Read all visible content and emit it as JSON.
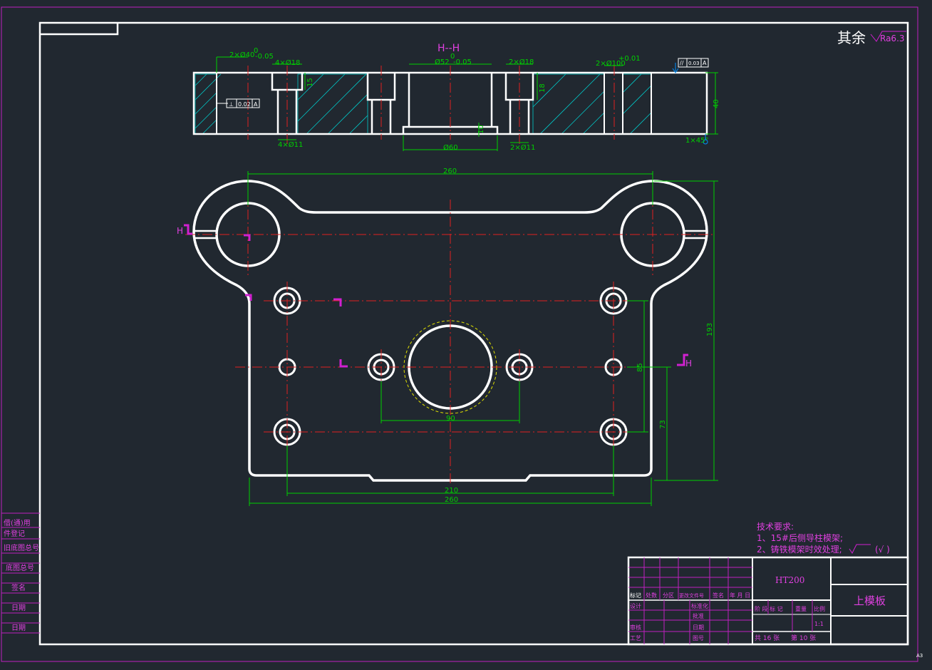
{
  "drawing": {
    "surface_note": {
      "prefix": "其余",
      "value": "Ra6.3"
    },
    "section_label": "H--H",
    "section_dims": {
      "d40": "2×Ø40",
      "d40_tol_upper": "0",
      "d40_tol_lower": "-0.05",
      "d18_left": "4×Ø18",
      "d52": "Ø52",
      "d52_tol_upper": "0",
      "d52_tol_lower": "-0.05",
      "d18_right": "2×Ø18",
      "d100": "2×Ø100",
      "d100_tol": "+0.01",
      "gtol_left_value": "0.02",
      "gtol_left_datum": "A",
      "gtol_right_value": "0.03",
      "gtol_right_datum": "A",
      "depth_15": "15",
      "depth_18": "18",
      "thickness_40": "40",
      "d11_left": "4×Ø11",
      "d60": "Ø60",
      "d11_right": "2×Ø11",
      "step_10": "10",
      "edge_note": "1×45°"
    },
    "plan_dims": {
      "top_width": "260",
      "height_193": "193",
      "spacing_85": "85",
      "spacing_73": "73",
      "spacing_90": "90",
      "inner_width": "210",
      "bottom_width": "260",
      "section_mark": "H"
    },
    "tech_req": {
      "title": "技术要求:",
      "line1": "1、15#后侧导柱模架;",
      "line2": "2、铸铁模架时效处理;",
      "line2_suffix": "(√ )"
    },
    "title_block": {
      "material": "HT200",
      "part_name": "上模板",
      "row_headers": [
        "标记",
        "处数",
        "分区",
        "更改文件号",
        "签名",
        "年 月 日"
      ],
      "roles": [
        "设计",
        "审核",
        "工艺"
      ],
      "roles_right": [
        "标准化",
        "批准",
        "日期",
        "图号"
      ],
      "stage_header": "阶 段 标 记",
      "weight_header": "重量",
      "scale_header": "比例",
      "scale_value": "1:1",
      "sheets_total": "共 16 张",
      "sheet_no": "第 10 张"
    },
    "left_strip": [
      "借(通)用",
      "件登记",
      "旧底图总号",
      "底图总号",
      "签名",
      "日期",
      "日期"
    ],
    "corner_tag": "A3"
  }
}
